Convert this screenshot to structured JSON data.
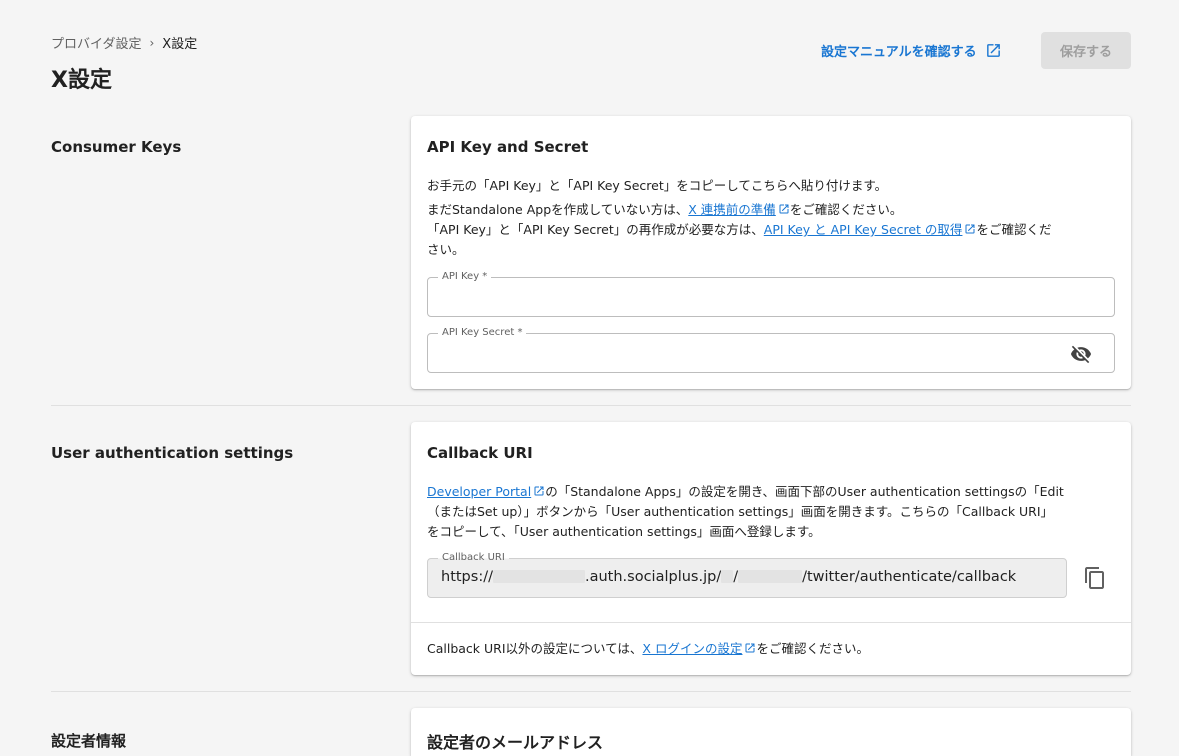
{
  "breadcrumb": {
    "parent": "プロバイダ設定",
    "separator": "›",
    "current": "X設定"
  },
  "page_title": "X設定",
  "header": {
    "manual_link": "設定マニュアルを確認する",
    "save_button": "保存する"
  },
  "consumer_keys": {
    "section_label": "Consumer Keys",
    "card_title": "API Key and Secret",
    "line1": "お手元の「API Key」と「API Key Secret」をコピーしてこちらへ貼り付けます。",
    "line2_pre": "まだStandalone Appを作成していない方は、",
    "line2_link": "X 連携前の準備",
    "line2_post": "をご確認ください。",
    "line3_pre": "「API Key」と「API Key Secret」の再作成が必要な方は、",
    "line3_link": "API Key と API Key Secret の取得",
    "line3_post": "をご確認くだ",
    "line4": "さい。",
    "api_key_label": "API Key *",
    "api_key_value": "",
    "api_secret_label": "API Key Secret *",
    "api_secret_value": ""
  },
  "user_auth": {
    "section_label": "User authentication settings",
    "card_title": "Callback URI",
    "line1_link": "Developer Portal",
    "line1_post": "の「Standalone Apps」の設定を開き、画面下部のUser authentication settingsの「Edit",
    "line2": "（またはSet up）」ボタンから「User authentication settings」画面を開きます。こちらの「Callback URI」",
    "line3": "をコピーして、「User authentication settings」画面へ登録します。",
    "callback_label": "Callback URI",
    "callback_part1": "https://",
    "callback_part2": ".auth.socialplus.jp/",
    "callback_part3": "/",
    "callback_part4": "/twitter/authenticate/callback",
    "footer_pre": "Callback URI以外の設定については、",
    "footer_link": "X ログインの設定",
    "footer_post": "をご確認ください。"
  },
  "setter_info": {
    "section_label": "設定者情報",
    "card_title": "設定者のメールアドレス"
  },
  "colors": {
    "accent": "#1976d2",
    "background": "#f5f5f5",
    "disabled_button": "#e0e0e0"
  },
  "icons": {
    "external_link": "external-link-icon",
    "visibility_off": "eye-off-icon",
    "copy": "copy-icon"
  }
}
